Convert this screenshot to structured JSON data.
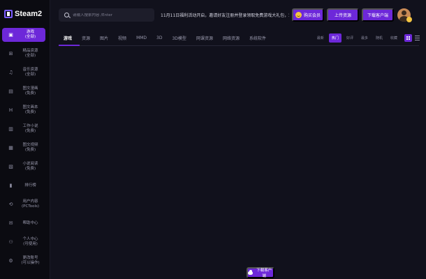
{
  "brand": {
    "name": "Steam2"
  },
  "sidebar": {
    "items": [
      {
        "label": "游戏\n(全部)",
        "icon": "gamepad-icon",
        "glyph": "▣",
        "active": true
      },
      {
        "label": "精品资源\n(全部)",
        "icon": "grid-icon",
        "glyph": "⊞",
        "active": false
      },
      {
        "label": "音乐资源\n(全部)",
        "icon": "music-icon",
        "glyph": "♫",
        "active": false
      },
      {
        "label": "图文漫画\n(免费)",
        "icon": "book-icon",
        "glyph": "▤",
        "active": false
      },
      {
        "label": "图文画本\n(免费)",
        "icon": "picture-icon",
        "glyph": "H",
        "active": false
      },
      {
        "label": "工作小说\n(免费)",
        "icon": "novel-icon",
        "glyph": "▥",
        "active": false
      },
      {
        "label": "图文视频\n(免费)",
        "icon": "video-icon",
        "glyph": "▦",
        "active": false
      },
      {
        "label": "小说阅读\n(免费)",
        "icon": "document-icon",
        "glyph": "▧",
        "active": false
      },
      {
        "label": "排行榜",
        "icon": "ranking-icon",
        "glyph": "▮",
        "active": false
      },
      {
        "label": "用户内容\n(PCTools)",
        "icon": "link-icon",
        "glyph": "⟲",
        "active": false
      },
      {
        "label": "帮助中心",
        "icon": "help-icon",
        "glyph": "✉",
        "active": false
      },
      {
        "label": "个人中心\n(可使用)",
        "icon": "user-icon",
        "glyph": "⚇",
        "active": false
      },
      {
        "label": "更改账号\n(可以操作)",
        "icon": "account-icon",
        "glyph": "⚙",
        "active": false
      }
    ]
  },
  "header": {
    "search_placeholder": "请输入搜索内容 /Enter",
    "notice": "11月11日福利活动开启，邀请好友注册并登录领取免费游戏大礼包，欢迎参加...",
    "buy_label": "购买会员",
    "upload_label": "上传资源",
    "download_label": "下载客户端"
  },
  "tabs": [
    "游戏",
    "资源",
    "图片",
    "视频",
    "MMD",
    "3D",
    "3D模型",
    "网课资源",
    "网络资源",
    "系统软件"
  ],
  "active_tab": "游戏",
  "filters": [
    "最新",
    "热门",
    "好评",
    "最多",
    "随机",
    "收藏"
  ],
  "active_filter": "热门",
  "footer": {
    "download_client_label": "下载客户端"
  },
  "colors": {
    "accent": "#6d28d9",
    "background": "#11111c",
    "sidebar": "#0b0b11"
  }
}
